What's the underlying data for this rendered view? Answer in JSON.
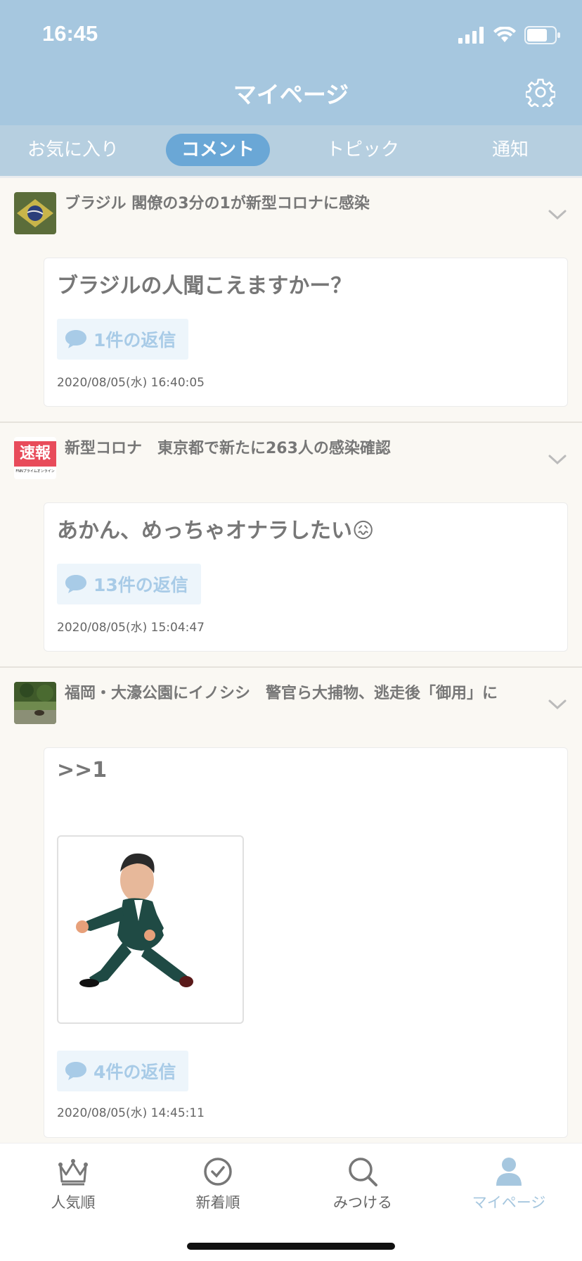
{
  "status_bar": {
    "time": "16:45"
  },
  "header": {
    "title": "マイページ"
  },
  "tabs": [
    {
      "label": "お気に入り",
      "active": false
    },
    {
      "label": "コメント",
      "active": true
    },
    {
      "label": "トピック",
      "active": false
    },
    {
      "label": "通知",
      "active": false
    }
  ],
  "topics": [
    {
      "title": "ブラジル 閣僚の3分の1が新型コロナに感染",
      "comment": "ブラジルの人聞こえますかー？",
      "replies": "1件の返信",
      "timestamp": "2020/08/05(水) 16:40:05"
    },
    {
      "title": "新型コロナ　東京都で新たに263人の感染確認",
      "thumb_text": "速報",
      "thumb_subtext": "FNNプライムオンライン",
      "comment": "あかん、めっちゃオナラしたい😖",
      "replies": "13件の返信",
      "timestamp": "2020/08/05(水) 15:04:47"
    },
    {
      "title": "福岡・大濠公園にイノシシ　警官ら大捕物、逃走後「御用」に",
      "comment": ">>1",
      "replies": "4件の返信",
      "timestamp": "2020/08/05(水) 14:45:11"
    }
  ],
  "bottom_nav": [
    {
      "label": "人気順",
      "icon": "crown-icon",
      "active": false
    },
    {
      "label": "新着順",
      "icon": "clock-check-icon",
      "active": false
    },
    {
      "label": "みつける",
      "icon": "search-icon",
      "active": false
    },
    {
      "label": "マイページ",
      "icon": "person-icon",
      "active": true
    }
  ],
  "colors": {
    "header": "#a6c7df",
    "tab_active": "#6aa7d6",
    "reply": "#a8cbe7"
  }
}
